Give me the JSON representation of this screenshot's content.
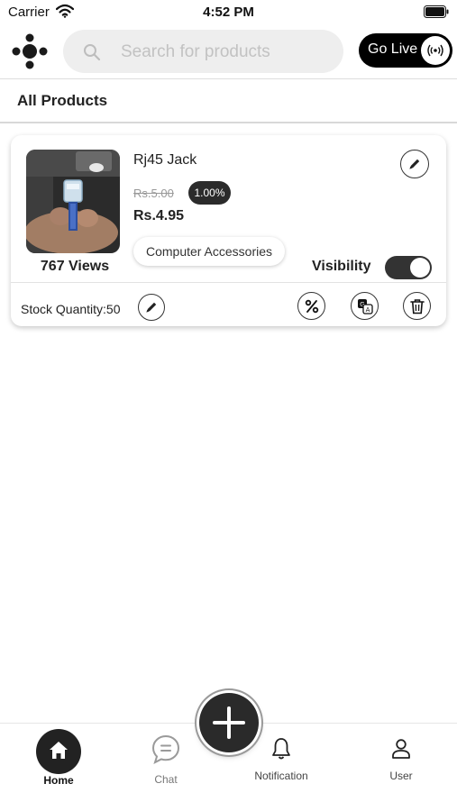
{
  "status_bar": {
    "carrier": "Carrier",
    "time": "4:52 PM"
  },
  "header": {
    "search_placeholder": "Search for products",
    "go_live_label": "Go Live"
  },
  "section": {
    "title": "All Products"
  },
  "products": [
    {
      "name": "Rj45 Jack",
      "old_price": "Rs.5.00",
      "discount": "1.00%",
      "new_price": "Rs.4.95",
      "category": "Computer Accessories",
      "views": "767 Views",
      "visibility_label": "Visibility",
      "visible": true,
      "stock_label": "Stock Quantity:50"
    }
  ],
  "bottom_nav": {
    "items": [
      {
        "label": "Home",
        "icon": "home-icon",
        "active": true
      },
      {
        "label": "Chat",
        "icon": "chat-icon",
        "active": false
      },
      {
        "label": "Notification",
        "icon": "bell-icon",
        "active": false
      },
      {
        "label": "User",
        "icon": "user-icon",
        "active": false
      }
    ],
    "fab_icon": "plus-icon"
  },
  "colors": {
    "accent_dark": "#222222",
    "search_bg": "#eeeeee",
    "badge_bg": "#2b2b2b"
  }
}
